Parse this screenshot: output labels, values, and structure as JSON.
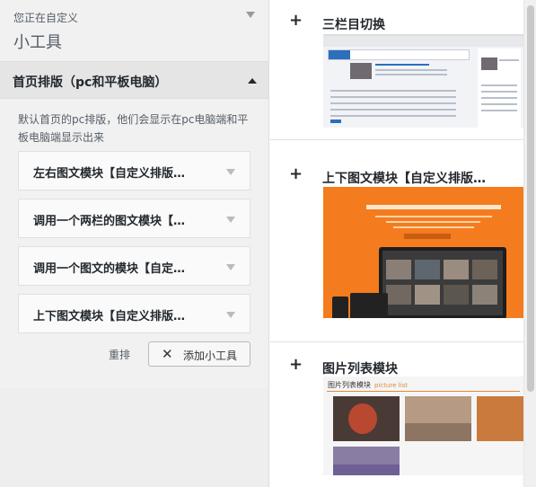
{
  "header": {
    "customizing_label": "您正在自定义",
    "title": "小工具"
  },
  "section": {
    "title": "首页排版（pc和平板电脑）",
    "description": "默认首页的pc排版，他们会显示在pc电脑端和平板电脑端显示出来"
  },
  "widgets": [
    {
      "title": "左右图文模块【自定义排版…"
    },
    {
      "title": "调用一个两栏的图文模块【…"
    },
    {
      "title": "调用一个图文的模块【自定…"
    },
    {
      "title": "上下图文模块【自定义排版…"
    }
  ],
  "actions": {
    "reorder_label": "重排",
    "add_widget_label": "添加小工具",
    "add_widget_icon": "close-x-icon"
  },
  "available_widgets": [
    {
      "title": "三栏目切换",
      "icon": "plus-icon"
    },
    {
      "title": "上下图文模块【自定义排版…",
      "icon": "plus-icon"
    },
    {
      "title": "图片列表模块",
      "icon": "plus-icon"
    }
  ],
  "previews": {
    "picture_list_header": "图片列表模块",
    "picture_list_header_en": "picture list"
  },
  "colors": {
    "panel_bg": "#f1f1f1",
    "section_header_bg": "#e5e5e5",
    "orange_banner": "#f47c1e",
    "tab_blue": "#2c6fbc"
  }
}
